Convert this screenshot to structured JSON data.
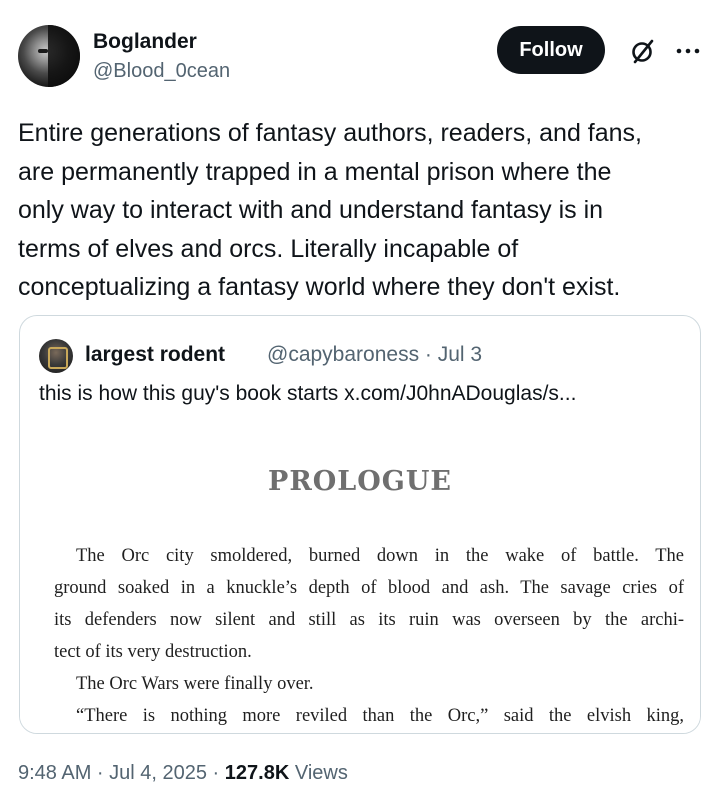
{
  "author": {
    "display_name": "Boglander",
    "handle": "@Blood_0cean"
  },
  "actions": {
    "follow_label": "Follow",
    "grok_icon": "slashed-circle-icon",
    "more_icon": "more-icon"
  },
  "tweet": {
    "text": "Entire generations of fantasy authors, readers, and fans,\nare permanently trapped in a mental prison where the\nonly way to interact with and understand fantasy is in\nterms of elves and orcs. Literally incapable of\nconceptualizing a fantasy world where they don't exist."
  },
  "quote": {
    "display_name": "largest rodent",
    "handle_date": "@capybaroness · Jul 3",
    "text": "this is how this guy's book starts  x.com/J0hnADouglas/s...",
    "page": {
      "heading": "PROLOGUE",
      "lines": [
        "The Orc city smoldered, burned down in the wake of battle. The",
        "ground soaked in a knuckle’s depth of blood and ash. The savage cries of",
        "its defenders now silent and still as its ruin was overseen by the archi-",
        "tect of its very destruction.",
        "The Orc Wars were finally over.",
        "“There is nothing more reviled than the Orc,” said the elvish king,"
      ]
    }
  },
  "meta": {
    "time_date": "9:48 AM · Jul 4, 2025 · ",
    "views_count": "127.8K",
    "views_label": " Views"
  }
}
